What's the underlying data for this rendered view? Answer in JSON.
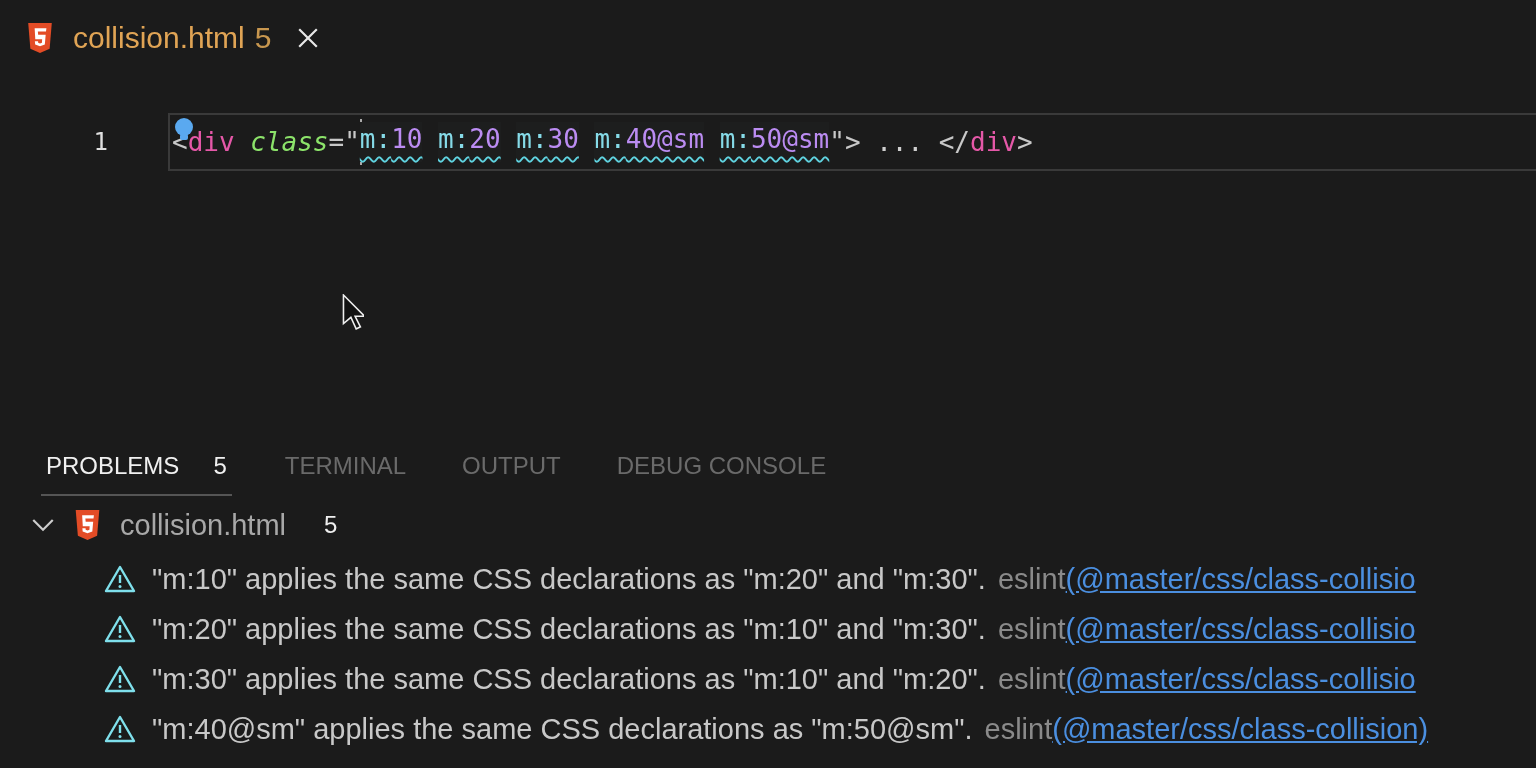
{
  "editor_tab": {
    "filename": "collision.html",
    "problem_count": "5"
  },
  "code": {
    "line_number": "1",
    "tokens": [
      {
        "kind": "punct",
        "text": "<"
      },
      {
        "kind": "tag",
        "text": "div"
      },
      {
        "kind": "attr",
        "text": "class",
        "gap": true
      },
      {
        "kind": "punct",
        "text": "=\""
      },
      {
        "kind": "class",
        "prefix": "m:",
        "value": "10",
        "warning": true,
        "cursor": true
      },
      {
        "kind": "class",
        "prefix": "m:",
        "value": "20",
        "warning": true,
        "gap": true
      },
      {
        "kind": "class",
        "prefix": "m:",
        "value": "30",
        "warning": true,
        "gap": true
      },
      {
        "kind": "class",
        "prefix": "m:",
        "value": "40@sm",
        "warning": true,
        "gap": true
      },
      {
        "kind": "class",
        "prefix": "m:",
        "value": "50@sm",
        "warning": true,
        "gap": true
      },
      {
        "kind": "punct",
        "text": "\">"
      },
      {
        "kind": "fold",
        "text": "...",
        "gap": true
      },
      {
        "kind": "punct",
        "text": "</",
        "gap": true
      },
      {
        "kind": "tag",
        "text": "div"
      },
      {
        "kind": "punct",
        "text": ">"
      }
    ]
  },
  "panel_tabs": [
    {
      "label": "PROBLEMS",
      "count": "5",
      "selected": true
    },
    {
      "label": "TERMINAL",
      "selected": false
    },
    {
      "label": "OUTPUT",
      "selected": false
    },
    {
      "label": "DEBUG CONSOLE",
      "selected": false
    }
  ],
  "problems": {
    "file": "collision.html",
    "count": "5",
    "expanded": true,
    "items": [
      {
        "message": "\"m:10\" applies the same CSS declarations as \"m:20\" and \"m:30\".",
        "source": "eslint",
        "rule": "(@master/css/class-collisio"
      },
      {
        "message": "\"m:20\" applies the same CSS declarations as \"m:10\" and \"m:30\".",
        "source": "eslint",
        "rule": "(@master/css/class-collisio"
      },
      {
        "message": "\"m:30\" applies the same CSS declarations as \"m:10\" and \"m:20\".",
        "source": "eslint",
        "rule": "(@master/css/class-collisio"
      },
      {
        "message": "\"m:40@sm\" applies the same CSS declarations as \"m:50@sm\".",
        "source": "eslint",
        "rule": "(@master/css/class-collision)"
      }
    ]
  }
}
